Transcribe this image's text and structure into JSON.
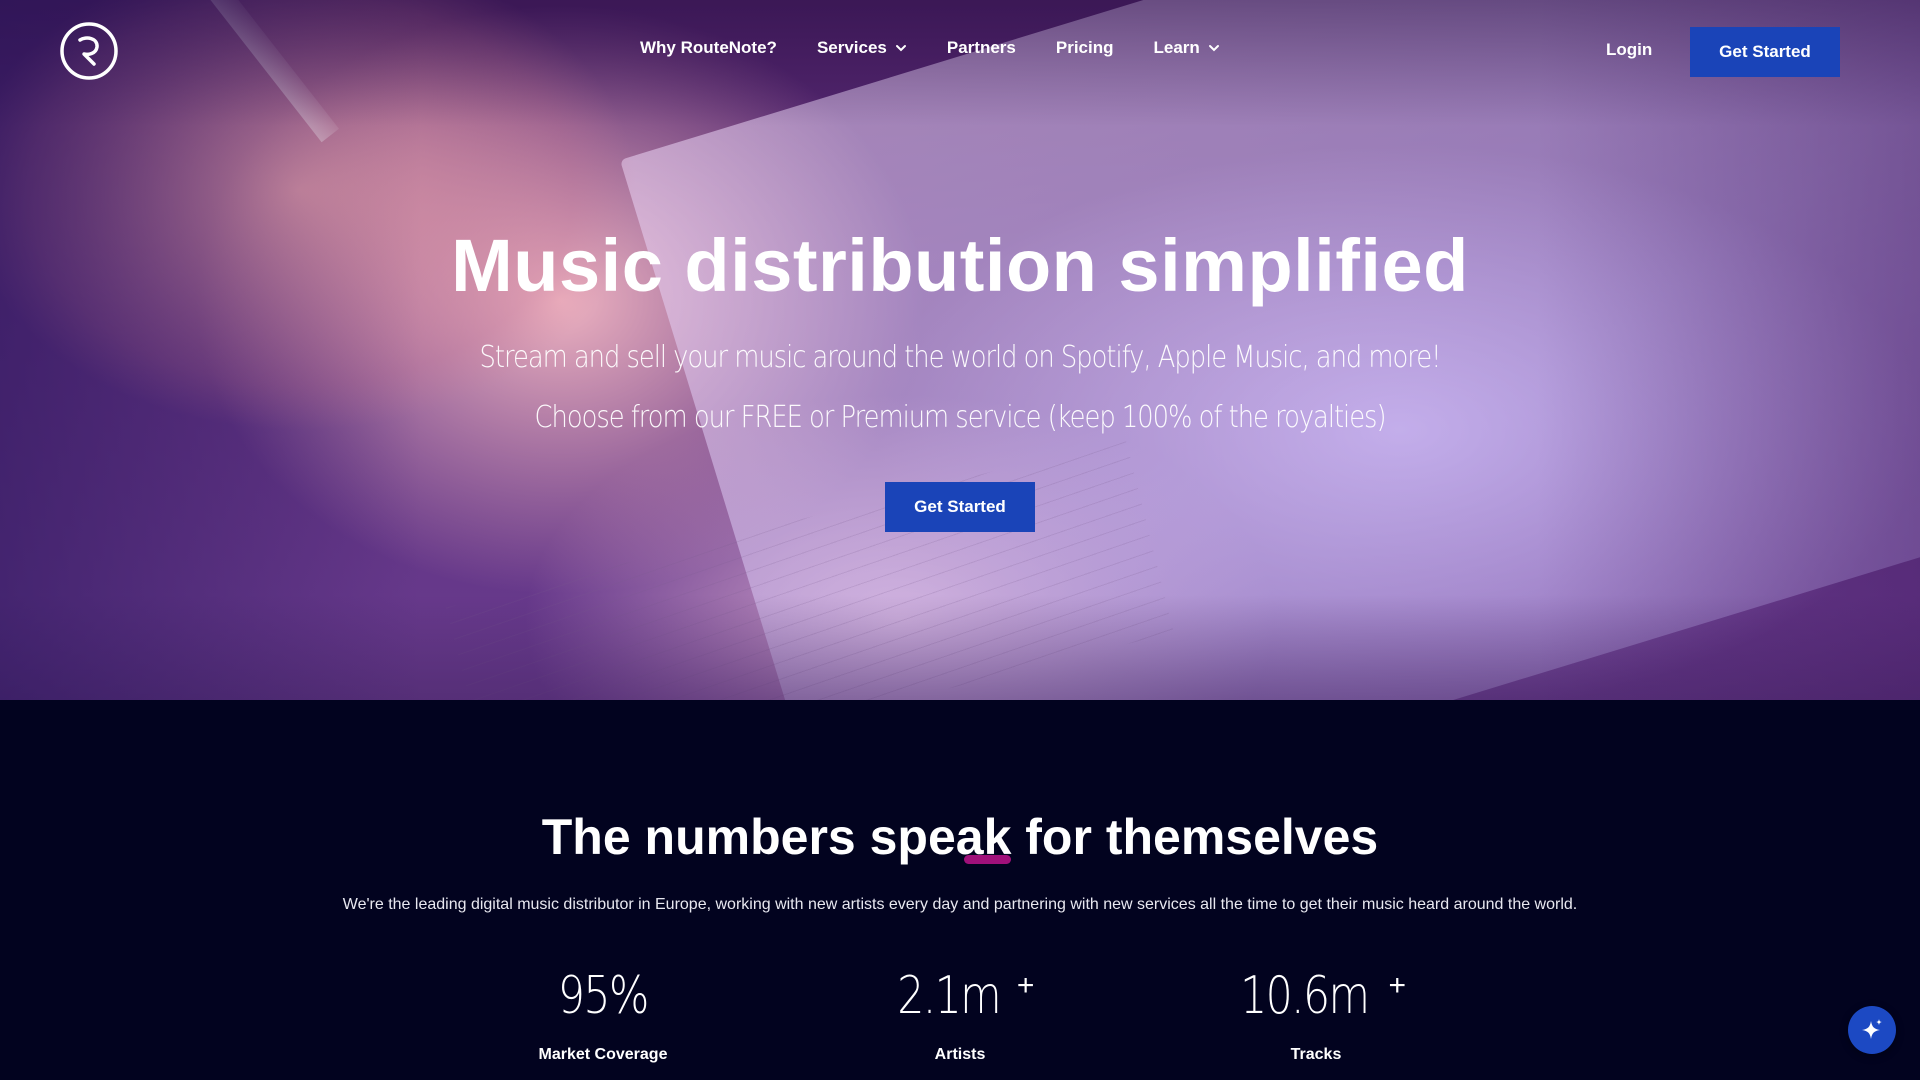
{
  "nav": {
    "logo_icon": "routenote-logo-icon",
    "links": [
      {
        "label": "Why RouteNote?",
        "has_dropdown": false
      },
      {
        "label": "Services",
        "has_dropdown": true
      },
      {
        "label": "Partners",
        "has_dropdown": false
      },
      {
        "label": "Pricing",
        "has_dropdown": false
      },
      {
        "label": "Learn",
        "has_dropdown": true
      }
    ],
    "login_label": "Login",
    "cta_label": "Get Started"
  },
  "hero": {
    "title_prefix": "Music distribution si",
    "title_highlight": "mplified",
    "subtitle_line1": "Stream and sell your music around the world on Spotify, Apple Music, and more!",
    "subtitle_line2": "Choose from our FREE or Premium service (keep 100% of the royalties)",
    "cta_label": "Get Started"
  },
  "stats": {
    "title_prefix": "The numbers sp",
    "title_highlight": "eak",
    "title_suffix": " for themselves",
    "description": "We're the leading digital music distributor in Europe, working with new artists every day and partnering with new services all the time to get their music heard around the world.",
    "items": [
      {
        "value": "95%",
        "plus": "",
        "label": "Market Coverage"
      },
      {
        "value": "2.1m",
        "plus": "+",
        "label": "Artists"
      },
      {
        "value": "10.6m",
        "plus": "+",
        "label": "Tracks"
      }
    ]
  },
  "assistant": {
    "icon": "sparkle-icon"
  },
  "colors": {
    "brand_blue": "#1a44b8",
    "stats_background": "#02031f",
    "highlight_pink": "#a0107a"
  }
}
